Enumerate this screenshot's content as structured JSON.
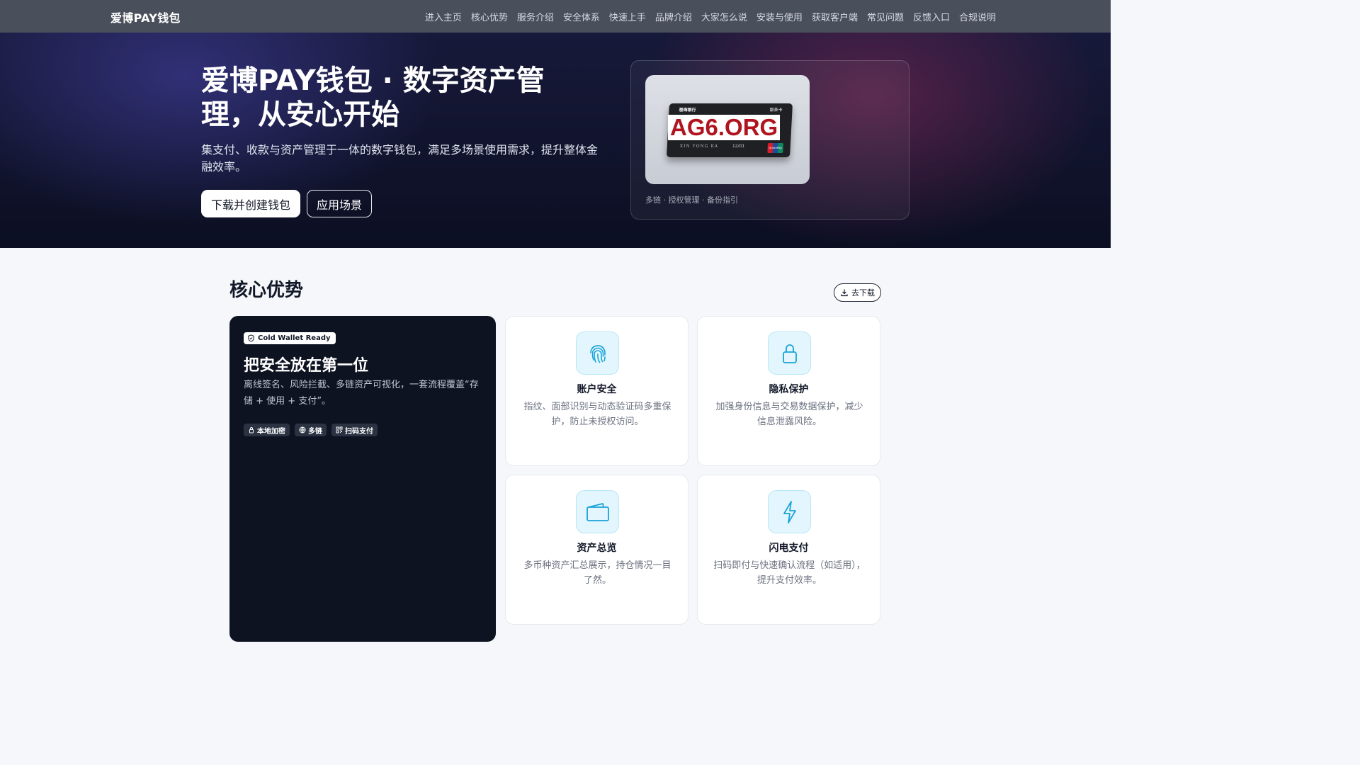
{
  "nav": {
    "brand": "爱博PAY钱包",
    "links": [
      "进入主页",
      "核心优势",
      "服务介绍",
      "安全体系",
      "快速上手",
      "品牌介绍",
      "大家怎么说",
      "安装与使用",
      "获取客户端",
      "常见问题",
      "反馈入口",
      "合规说明"
    ]
  },
  "hero": {
    "title": "爱博PAY钱包 · 数字资产管理，从安心开始",
    "subtitle": "集支付、收款与资产管理于一体的数字钱包，满足多场景使用需求，提升整体金融效率。",
    "primary_button": "下载并创建钱包",
    "secondary_button": "应用场景",
    "image": {
      "watermark": "AG6.ORG",
      "card_bank": "渤海银行",
      "card_type": "银茶卡",
      "card_name": "XIN YONG KA",
      "card_valid": "12/01",
      "card_network": "UnionPay"
    },
    "caption": "多链 · 授权管理 · 备份指引"
  },
  "advantages": {
    "title": "核心优势",
    "download_label": "去下载",
    "feature": {
      "badge": "Cold Wallet Ready",
      "title": "把安全放在第一位",
      "description": "离线签名、风险拦截、多链资产可视化，一套流程覆盖“存储 + 使用 + 支付”。",
      "tags": [
        {
          "icon": "lock-icon",
          "label": "本地加密"
        },
        {
          "icon": "globe-icon",
          "label": "多链"
        },
        {
          "icon": "qr-icon",
          "label": "扫码支付"
        }
      ]
    },
    "cards": [
      {
        "icon": "fingerprint-icon",
        "title": "账户安全",
        "desc": "指纹、面部识别与动态验证码多重保护，防止未授权访问。"
      },
      {
        "icon": "lock-icon",
        "title": "隐私保护",
        "desc": "加强身份信息与交易数据保护，减少信息泄露风险。"
      },
      {
        "icon": "wallet-icon",
        "title": "资产总览",
        "desc": "多币种资产汇总展示，持仓情况一目了然。"
      },
      {
        "icon": "lightning-icon",
        "title": "闪电支付",
        "desc": "扫码即付与快速确认流程（如适用），提升支付效率。"
      }
    ]
  },
  "colors": {
    "accent": "#1aa3d9",
    "nav_bg": "#4a4f5c",
    "hero_bg": "#0c0f22",
    "feature_bg": "#0d1321"
  }
}
